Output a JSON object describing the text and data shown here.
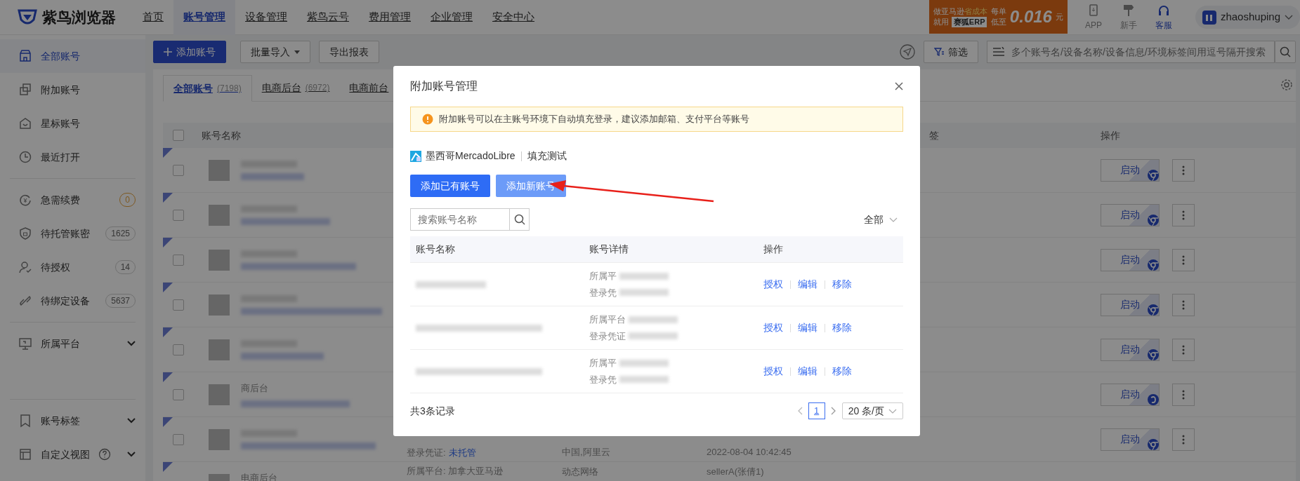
{
  "top_nav": {
    "logo": "紫鸟浏览器",
    "items": [
      {
        "label": "首页",
        "selected": false
      },
      {
        "label": "账号管理",
        "selected": true
      },
      {
        "label": "设备管理",
        "selected": false
      },
      {
        "label": "紫鸟云号",
        "selected": false
      },
      {
        "label": "费用管理",
        "selected": false
      },
      {
        "label": "企业管理",
        "selected": false
      },
      {
        "label": "安全中心",
        "selected": false
      }
    ],
    "ad_banner": {
      "line1": "做亚马逊",
      "highlight": "省成本",
      "line2": "就用",
      "brand": "赛狐ERP",
      "per_order": "每单",
      "as_low": "低至",
      "price": "0.016",
      "unit": "元"
    },
    "tools": [
      {
        "label": "APP",
        "selected": false
      },
      {
        "label": "新手",
        "selected": false
      },
      {
        "label": "客服",
        "selected": true
      }
    ],
    "user": {
      "name": "zhaoshuping"
    }
  },
  "sidebar": {
    "groups": [
      [
        {
          "label": "全部账号",
          "selected": true
        },
        {
          "label": "附加账号",
          "selected": false
        },
        {
          "label": "星标账号",
          "selected": false
        },
        {
          "label": "最近打开",
          "selected": false
        }
      ],
      [
        {
          "label": "急需续费",
          "selected": false,
          "badge": "0",
          "badge_warning": true
        },
        {
          "label": "待托管账密",
          "selected": false,
          "badge": "1625",
          "badge_warning": false
        },
        {
          "label": "待授权",
          "selected": false,
          "badge": "14",
          "badge_warning": false
        },
        {
          "label": "待绑定设备",
          "selected": false,
          "badge": "5637",
          "badge_warning": false
        }
      ],
      [
        {
          "label": "所属平台",
          "selected": false,
          "expanded": false
        }
      ],
      [
        {
          "label": "账号标签",
          "selected": false,
          "expanded": false
        },
        {
          "label": "自定义视图",
          "selected": false,
          "expanded": false,
          "help": true
        }
      ]
    ]
  },
  "toolbar": {
    "add_button": "添加账号",
    "import_button": "批量导入",
    "export_button": "导出报表",
    "filter_button": "筛选",
    "search": {
      "placeholder": "多个账号名/设备名称/设备信息/环境标签间用逗号隔开搜索"
    }
  },
  "tabs": [
    {
      "label": "全部账号",
      "count": "(7198)",
      "selected": true
    },
    {
      "label": "电商后台",
      "count": "(6972)",
      "selected": false
    },
    {
      "label": "电商前台",
      "selected": false
    }
  ],
  "table": {
    "columns": {
      "name": "账号名称",
      "column_6": "签",
      "actions": "操作"
    },
    "all_checked": false,
    "rows": [
      {
        "checked": false,
        "launch": "启动",
        "kind": "ring"
      },
      {
        "checked": false,
        "launch": "启动",
        "kind": "ring"
      },
      {
        "checked": false,
        "launch": "启动",
        "kind": "ring"
      },
      {
        "checked": false,
        "launch": "启动",
        "kind": "ring"
      },
      {
        "checked": false,
        "launch": "启动",
        "kind": "ring"
      },
      {
        "checked": false,
        "launch": "启动",
        "kind": "swirl",
        "tag": "商后台"
      },
      {
        "checked": false,
        "launch": "启动",
        "kind": "ring",
        "credential_label": "登录凭证:",
        "credential_value": "未托管",
        "network": "中国,阿里云",
        "time": "2022-08-04 10:42:45"
      },
      {
        "tag": "电商后台",
        "platform": "所属平台: 加拿大亚马逊",
        "network": "动态网络",
        "user": "sellerA(张倩1)"
      }
    ]
  },
  "modal": {
    "title": "附加账号管理",
    "alert": "附加账号可以在主账号环境下自动填充登录，建议添加邮箱、支付平台等账号",
    "platform": "墨西哥MercadoLibre",
    "env": "填充测试",
    "buttons": [
      {
        "label": "添加已有账号",
        "kind": "primary"
      },
      {
        "label": "添加新账号",
        "kind": "light"
      }
    ],
    "search": {
      "placeholder": "搜索账号名称"
    },
    "filter": "全部",
    "columns": [
      "账号名称",
      "账号详情",
      "操作"
    ],
    "rows": [
      {
        "detail_line1": "所属平",
        "detail_line2": "登录凭",
        "actions": [
          "授权",
          "编辑",
          "移除"
        ]
      },
      {
        "detail_line1": "所属平台",
        "detail_line2": "登录凭证",
        "actions": [
          "授权",
          "编辑",
          "移除"
        ]
      },
      {
        "detail_line1": "所属平",
        "detail_line2": "登录凭",
        "actions": [
          "授权",
          "编辑",
          "移除"
        ]
      }
    ],
    "total": "共3条记录",
    "pages": [
      {
        "label": "1",
        "selected": true
      }
    ],
    "page_size": "20 条/页"
  }
}
